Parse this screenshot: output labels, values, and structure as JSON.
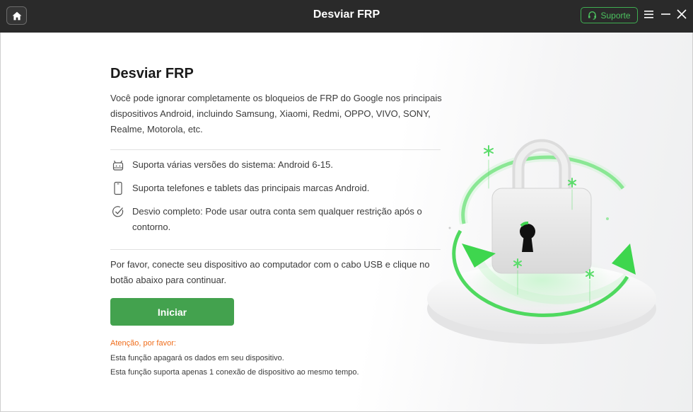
{
  "window": {
    "title": "Desviar FRP",
    "support_label": "Suporte"
  },
  "main": {
    "page_title": "Desviar FRP",
    "description": "Você pode ignorar completamente os bloqueios de FRP do Google nos principais dispositivos Android, incluindo Samsung, Xiaomi, Redmi, OPPO, VIVO, SONY, Realme, Motorola, etc.",
    "features": [
      {
        "icon": "android-icon",
        "text": "Suporta várias versões do sistema: Android 6-15."
      },
      {
        "icon": "phone-icon",
        "text": "Suporta telefones e tablets das principais marcas Android."
      },
      {
        "icon": "check-circle-icon",
        "text": "Desvio completo: Pode usar outra conta sem qualquer restrição após o contorno."
      }
    ],
    "instruction": "Por favor, conecte seu dispositivo ao computador com o cabo USB e clique no botão abaixo para continuar.",
    "start_button": "Iniciar",
    "warning": {
      "title": "Atenção, por favor:",
      "lines": [
        "Esta função apagará os dados em seu dispositivo.",
        "Esta função suporta apenas 1 conexão de dispositivo ao mesmo tempo."
      ]
    }
  },
  "colors": {
    "titlebar": "#2a2a2a",
    "accent_green": "#43a24e",
    "support_green": "#4cc25f",
    "warning_orange": "#ef6c1a"
  }
}
